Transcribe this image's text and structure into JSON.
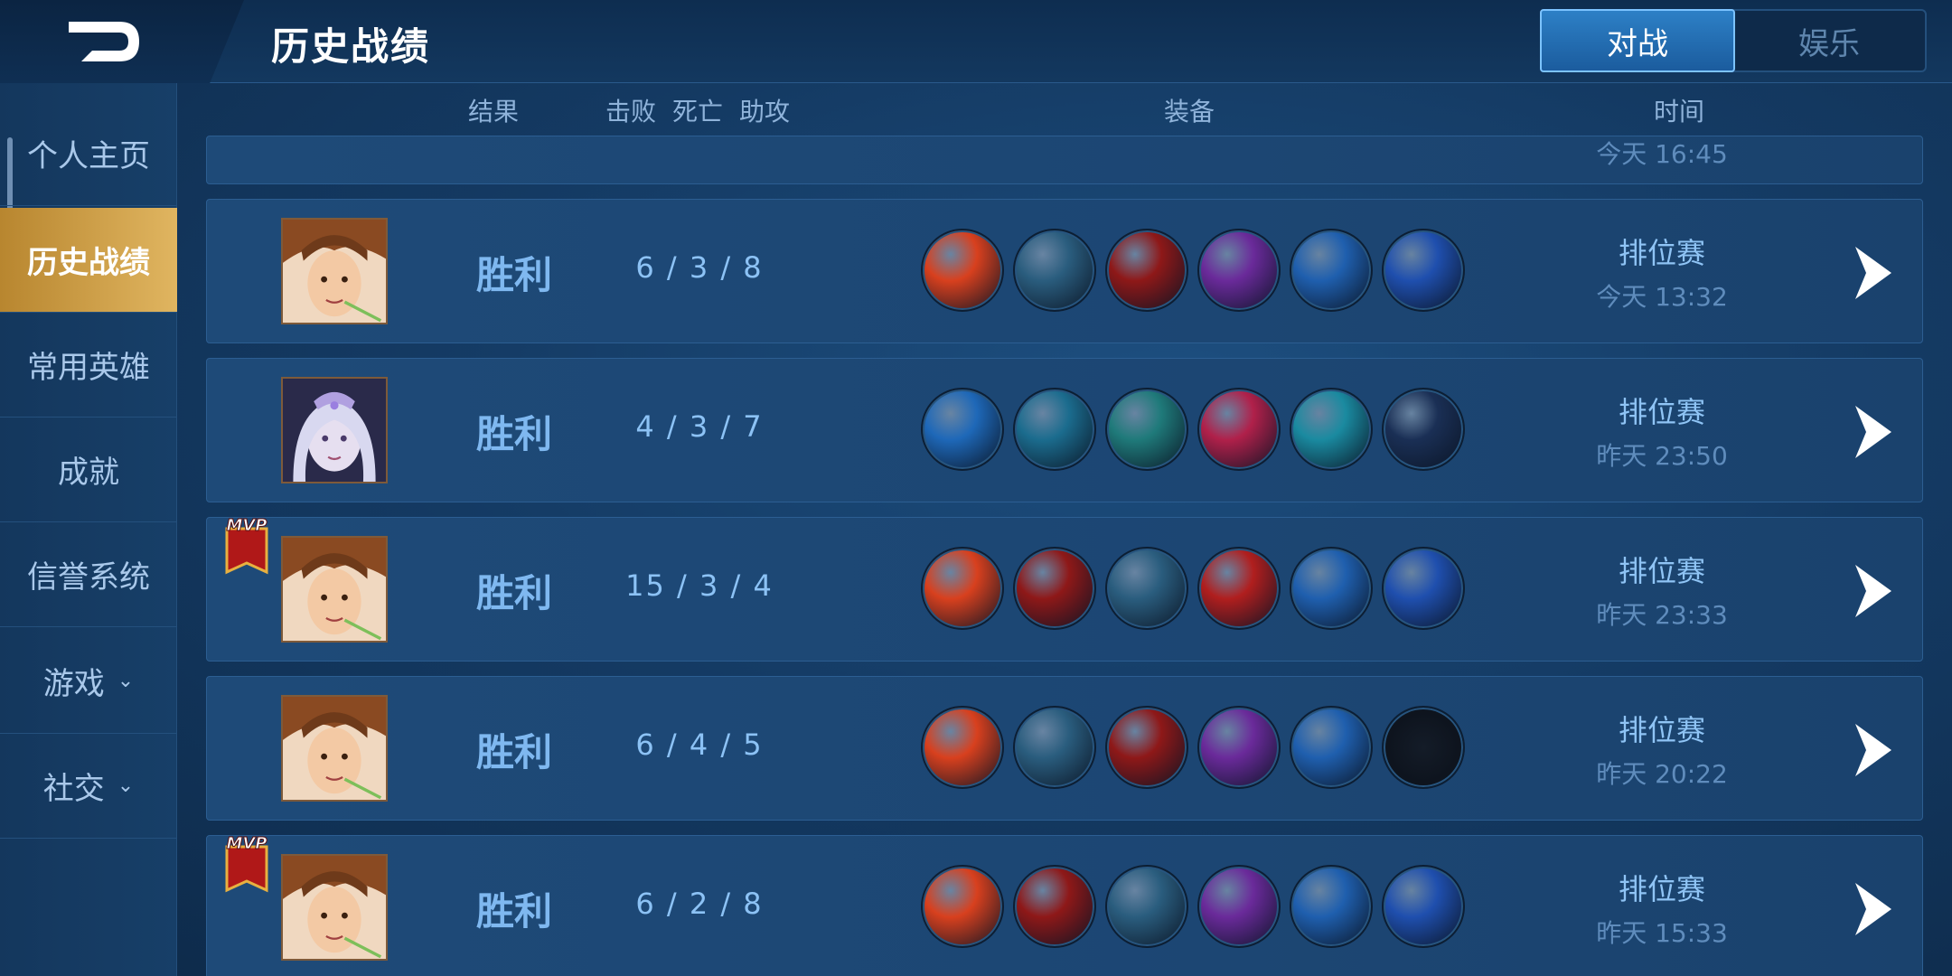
{
  "header": {
    "title": "历史战绩",
    "tabs": [
      {
        "label": "对战",
        "active": true
      },
      {
        "label": "娱乐",
        "active": false
      }
    ]
  },
  "sidebar": {
    "items": [
      {
        "label": "个人主页",
        "active": false
      },
      {
        "label": "历史战绩",
        "active": true
      },
      {
        "label": "常用英雄",
        "active": false
      },
      {
        "label": "成就",
        "active": false
      },
      {
        "label": "信誉系统",
        "active": false
      },
      {
        "label": "游戏",
        "active": false,
        "chevron": "⌄"
      },
      {
        "label": "社交",
        "active": false,
        "chevron": "⌄"
      }
    ]
  },
  "columns": {
    "result": "结果",
    "kills": "击败",
    "deaths": "死亡",
    "assists": "助攻",
    "equipment": "装备",
    "time": "时间"
  },
  "partial_row": {
    "time": "今天 16:45"
  },
  "matches": [
    {
      "result": "胜利",
      "kda": "6 / 3 / 8",
      "mode": "排位赛",
      "time": "今天 13:32",
      "mvp": false,
      "hero": "hero-a",
      "items": [
        "#d8401e",
        "#2a5d7e",
        "#8e1818",
        "#6a2a9a",
        "#1f5fae",
        "#1f4fae"
      ]
    },
    {
      "result": "胜利",
      "kda": "4 / 3 / 7",
      "mode": "排位赛",
      "time": "昨天 23:50",
      "mvp": false,
      "hero": "hero-b",
      "items": [
        "#1e68b8",
        "#1b6c8e",
        "#1f7a7a",
        "#b0204a",
        "#1a8aa0",
        "#1a2f55"
      ]
    },
    {
      "result": "胜利",
      "kda": "15 / 3 / 4",
      "mode": "排位赛",
      "time": "昨天 23:33",
      "mvp": true,
      "hero": "hero-a",
      "items": [
        "#d8401e",
        "#8e1818",
        "#2a5d7e",
        "#b01e1e",
        "#1f5fae",
        "#1f4fae"
      ]
    },
    {
      "result": "胜利",
      "kda": "6 / 4 / 5",
      "mode": "排位赛",
      "time": "昨天 20:22",
      "mvp": false,
      "hero": "hero-a",
      "items": [
        "#d8401e",
        "#2a5d7e",
        "#8e1818",
        "#6a2a9a",
        "#1f5fae",
        "#0f1a2a"
      ]
    },
    {
      "result": "胜利",
      "kda": "6 / 2 / 8",
      "mode": "排位赛",
      "time": "昨天 15:33",
      "mvp": true,
      "hero": "hero-a",
      "items": [
        "#d8401e",
        "#8e1818",
        "#2a5d7e",
        "#6a2a9a",
        "#1f5fae",
        "#1f4fae"
      ]
    }
  ],
  "mvp_label": "MVP",
  "icons": {
    "back": "back-arrow-icon",
    "detail": "chevron-right-icon"
  }
}
